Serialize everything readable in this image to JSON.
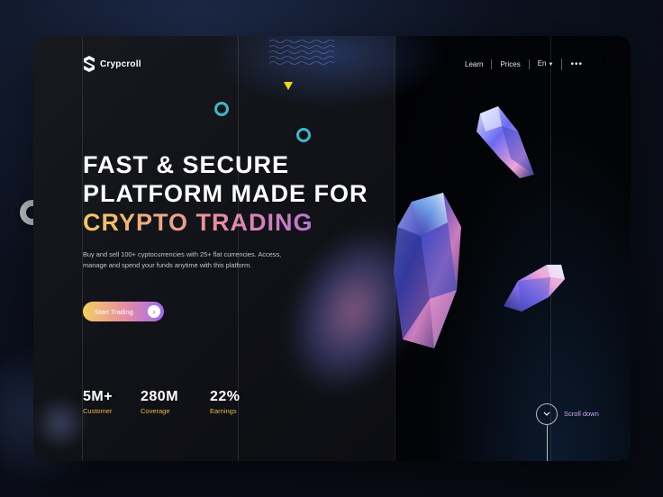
{
  "brand": {
    "name": "Crypcroll"
  },
  "nav": {
    "items": [
      {
        "label": "Learn"
      },
      {
        "label": "Prices"
      },
      {
        "label": "En",
        "icon": "chevron-down-icon"
      }
    ],
    "more_label": "•••"
  },
  "hero": {
    "line1": "FAST & SECURE",
    "line2": "PLATFORM MADE FOR",
    "line3": "CRYPTO TRADING",
    "description": "Buy and sell 100+ cyptocurrencies with 25+ flat currencies. Access, manage and spend your funds anytime with this platform.",
    "cta_label": "Start Trading",
    "cta_icon": "arrow-right-icon"
  },
  "stats": [
    {
      "value": "5M+",
      "label": "Customer"
    },
    {
      "value": "280M",
      "label": "Coverage"
    },
    {
      "value": "22%",
      "label": "Earnings"
    }
  ],
  "scroll": {
    "label": "Scroll down",
    "icon": "chevron-down-icon"
  },
  "colors": {
    "accent_yellow": "#f5d90a",
    "accent_teal": "#3fb6c8",
    "gradient_start": "#f4c95d",
    "gradient_mid": "#e58aa6",
    "gradient_end": "#9a6cf0",
    "stat_label": "#e8b84a"
  }
}
